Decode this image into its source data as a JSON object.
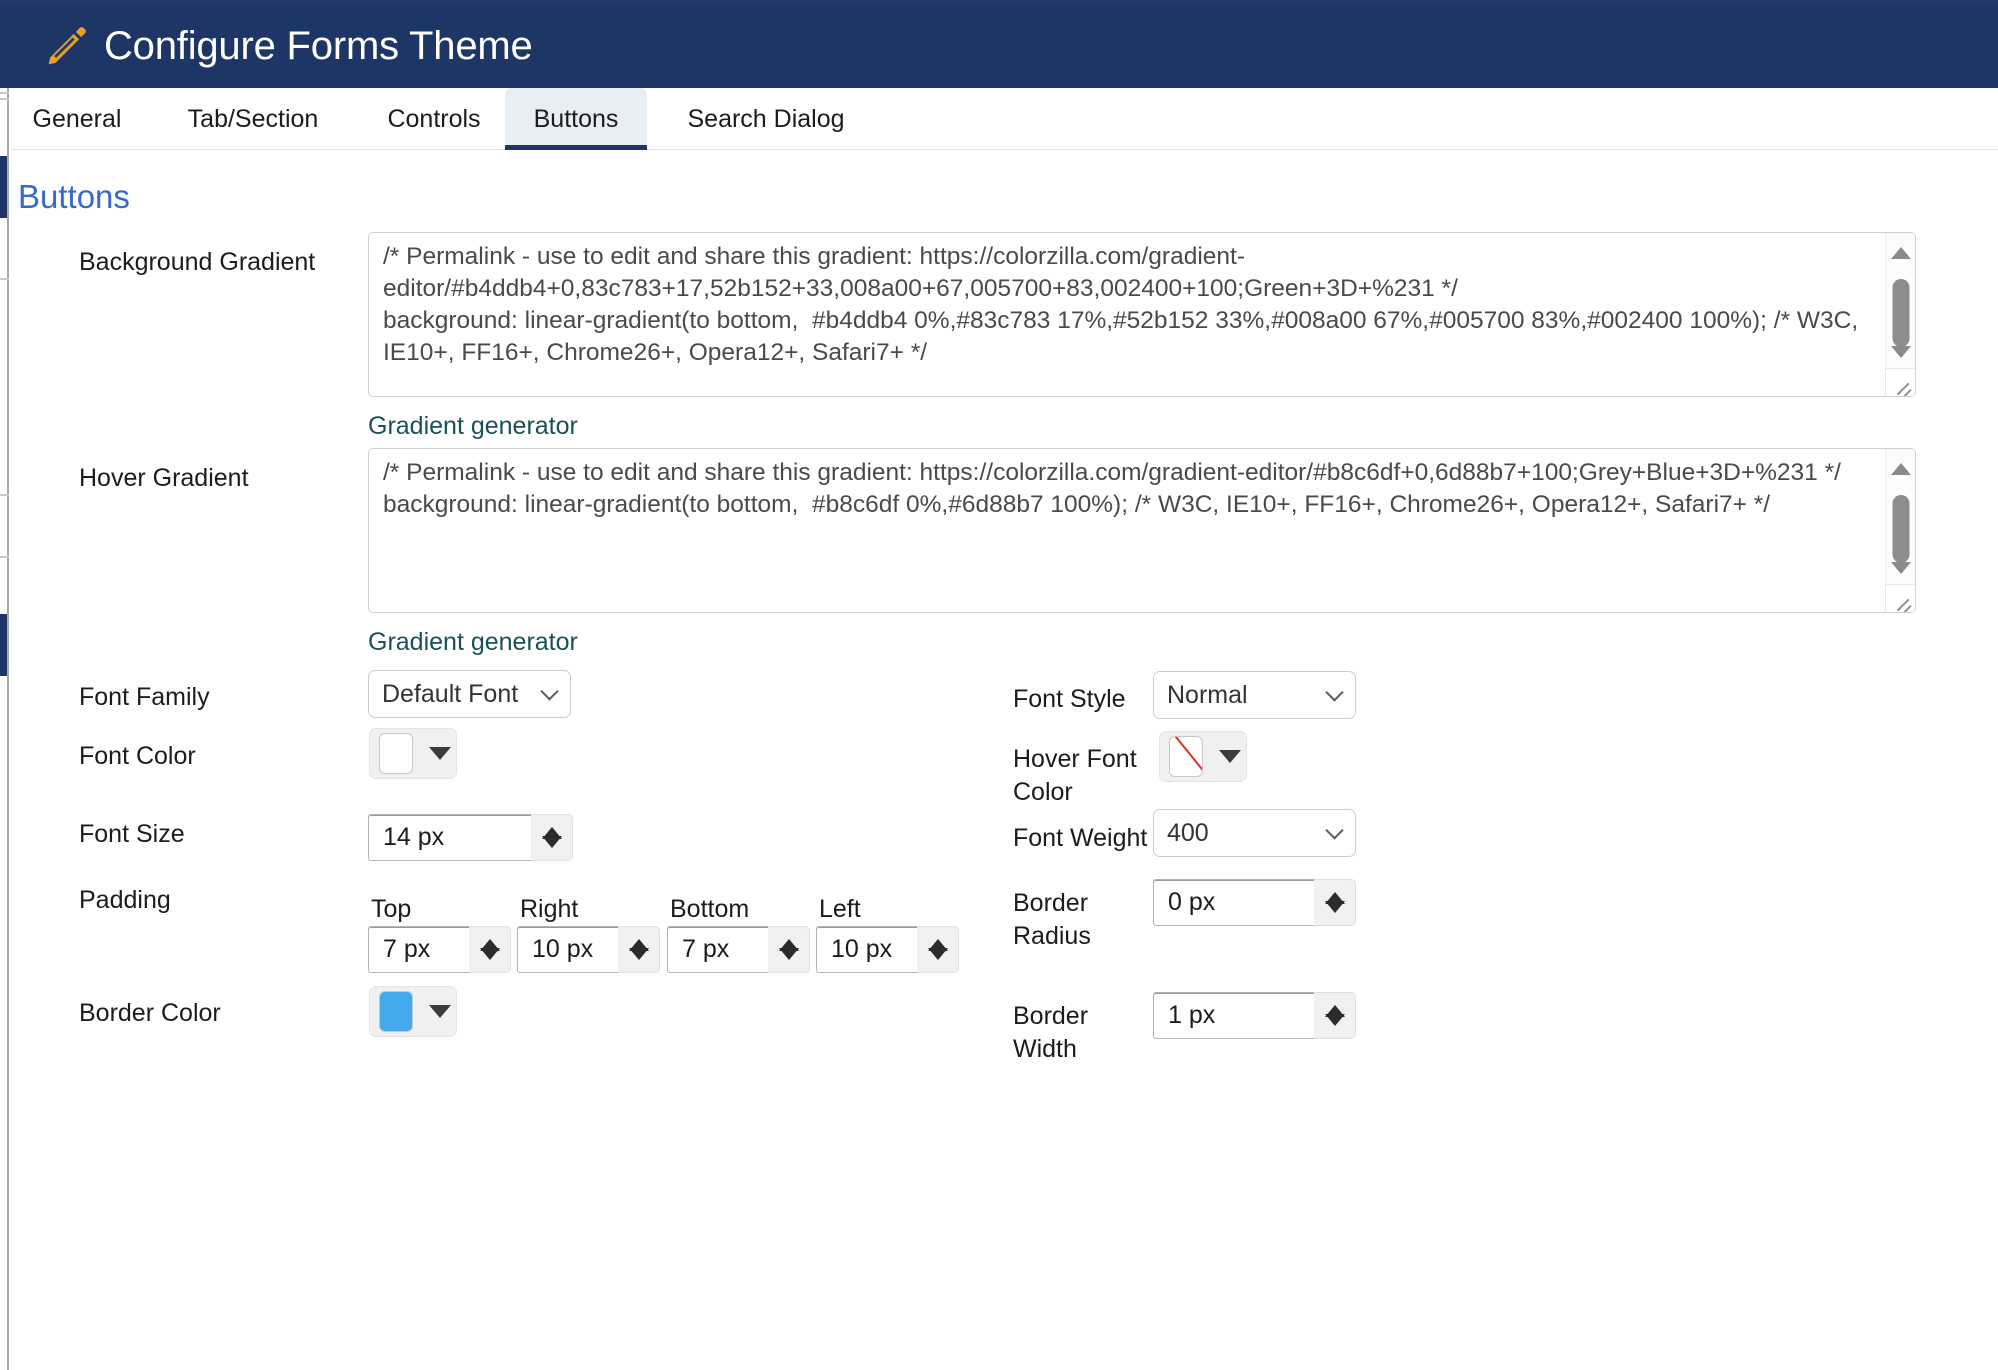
{
  "window": {
    "top_sliver_text": "· ·· ·  ··· ·· ·· ··  ·· ··· · ·· ··  ··· ·· ·",
    "accent_navy": "#1d3665",
    "accent_blue": "#3a68cd",
    "link_teal": "#1a5258",
    "pencil_color": "#E5A21F"
  },
  "header": {
    "title": "Configure Forms Theme",
    "icon": "pencil-icon"
  },
  "tabs": [
    {
      "label": "General",
      "active": false
    },
    {
      "label": "Tab/Section",
      "active": false
    },
    {
      "label": "Controls",
      "active": false
    },
    {
      "label": "Buttons",
      "active": true
    },
    {
      "label": "Search Dialog",
      "active": false
    }
  ],
  "section": {
    "title": "Buttons"
  },
  "fields": {
    "background_gradient": {
      "label": "Background Gradient",
      "value": "/* Permalink - use to edit and share this gradient: https://colorzilla.com/gradient-editor/#b4ddb4+0,83c783+17,52b152+33,008a00+67,005700+83,002400+100;Green+3D+%231 */\nbackground: linear-gradient(to bottom,  #b4ddb4 0%,#83c783 17%,#52b152 33%,#008a00 67%,#005700 83%,#002400 100%); /* W3C, IE10+, FF16+, Chrome26+, Opera12+, Safari7+ */",
      "link_label": "Gradient generator"
    },
    "hover_gradient": {
      "label": "Hover Gradient",
      "value": "/* Permalink - use to edit and share this gradient: https://colorzilla.com/gradient-editor/#b8c6df+0,6d88b7+100;Grey+Blue+3D+%231 */\nbackground: linear-gradient(to bottom,  #b8c6df 0%,#6d88b7 100%); /* W3C, IE10+, FF16+, Chrome26+, Opera12+, Safari7+ */",
      "link_label": "Gradient generator"
    },
    "font_family": {
      "label": "Font Family",
      "value": "Default Font"
    },
    "font_style": {
      "label": "Font Style",
      "value": "Normal"
    },
    "font_color": {
      "label": "Font Color",
      "swatch": "#ffffff",
      "no_color": false
    },
    "hover_font_color": {
      "label": "Hover Font Color",
      "swatch": "#ffffff",
      "no_color": true
    },
    "font_size": {
      "label": "Font Size",
      "value": "14 px"
    },
    "font_weight": {
      "label": "Font Weight",
      "value": "400"
    },
    "padding": {
      "label": "Padding",
      "top": {
        "header": "Top",
        "value": "7 px"
      },
      "right": {
        "header": "Right",
        "value": "10 px"
      },
      "bottom": {
        "header": "Bottom",
        "value": "7 px"
      },
      "left": {
        "header": "Left",
        "value": "10 px"
      }
    },
    "border_radius": {
      "label": "Border Radius",
      "value": "0 px"
    },
    "border_color": {
      "label": "Border Color",
      "swatch": "#44aaf0",
      "no_color": false
    },
    "border_width": {
      "label": "Border Width",
      "value": "1 px"
    }
  }
}
